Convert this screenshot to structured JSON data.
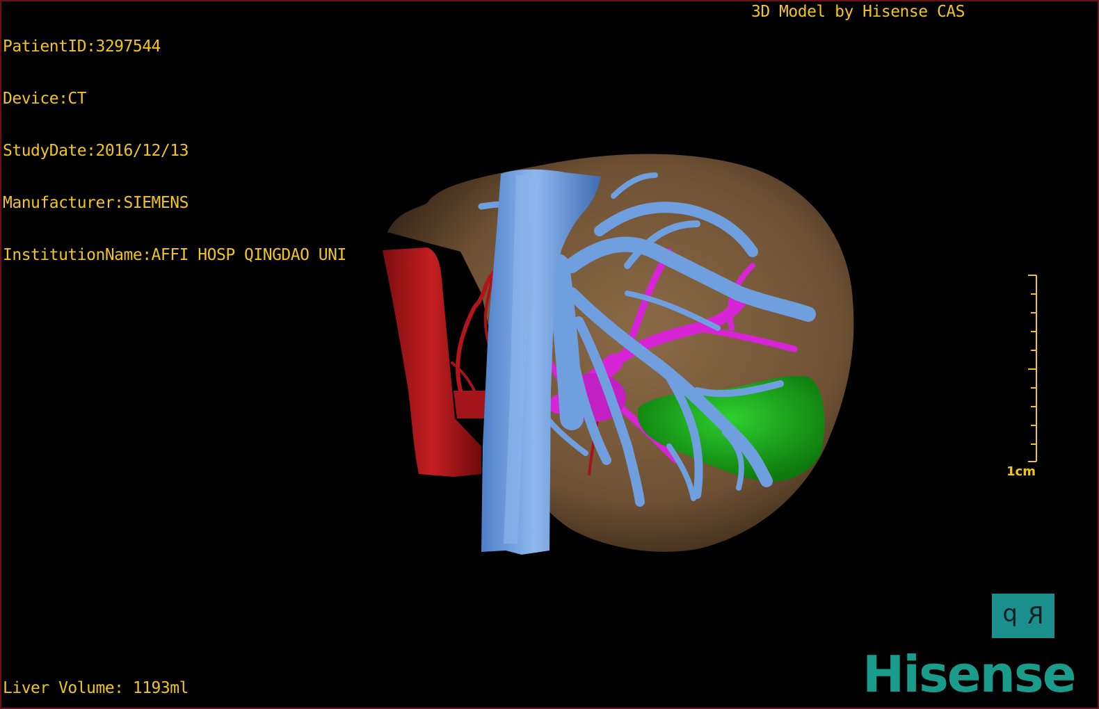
{
  "study_info": {
    "patient_id": "PatientID:3297544",
    "device": "Device:CT",
    "study_date": "StudyDate:2016/12/13",
    "manufacturer": "Manufacturer:SIEMENS",
    "institution": "InstitutionName:AFFI HOSP QINGDAO UNI"
  },
  "model_credit": "3D Model by Hisense CAS",
  "liver_volume": "Liver Volume: 1193ml",
  "scale": {
    "label": "1cm"
  },
  "orientation": {
    "left_glyph": "d",
    "right_glyph": "R"
  },
  "brand": {
    "name": "Hisense"
  },
  "colors": {
    "overlay_text": "#f2c51a",
    "liver": "#7a5a3a",
    "hepatic_veins": "#6f9fde",
    "portal_veins": "#d624d6",
    "arteries": "#b3161a",
    "tumor": "#1da51d",
    "brand": "#1a9c8d",
    "viewport_border": "#6b0f14"
  },
  "structures": [
    "liver-surface",
    "inferior-vena-cava",
    "hepatic-vein-branches",
    "portal-vein-branches",
    "hepatic-artery",
    "aorta",
    "tumor-lesion"
  ]
}
